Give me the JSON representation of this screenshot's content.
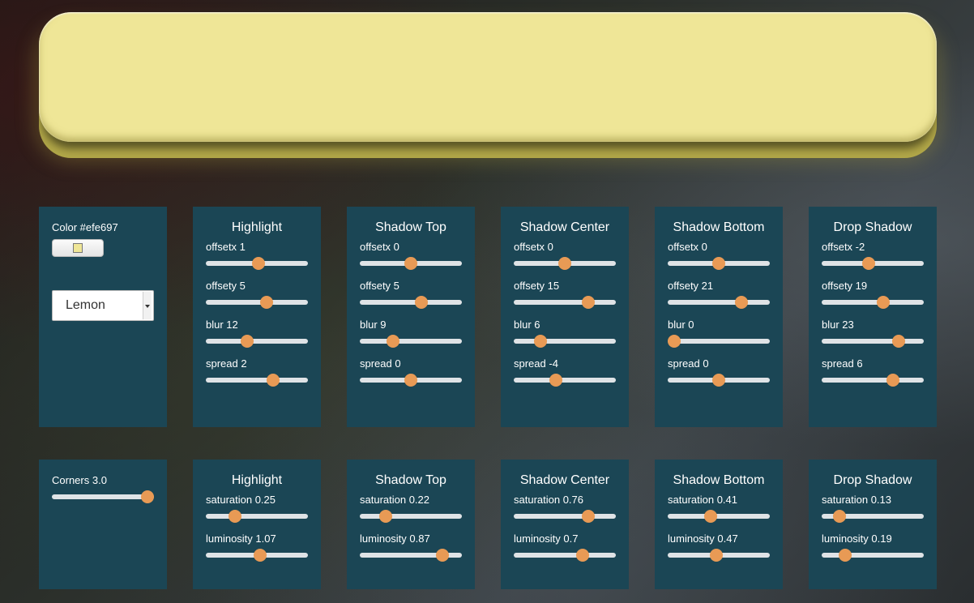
{
  "preview": {
    "color": "#efe697",
    "bottom_color": "#b7ad4d"
  },
  "panel_color": "#1b4655",
  "slider_thumb_color": "#e89a55",
  "color_panel": {
    "color_label": "Color #efe697",
    "swatch_color": "#efe697",
    "palette_select": {
      "selected": "Lemon"
    }
  },
  "corners_panel": {
    "label": "Corners 3.0",
    "level": 1.0
  },
  "shadow_panels": [
    {
      "title": "Highlight",
      "controls": [
        {
          "label": "offsetx 1",
          "level": 0.52
        },
        {
          "label": "offsety 5",
          "level": 0.61
        },
        {
          "label": "blur 12",
          "level": 0.39
        },
        {
          "label": "spread 2",
          "level": 0.68
        }
      ]
    },
    {
      "title": "Shadow Top",
      "controls": [
        {
          "label": "offsetx 0",
          "level": 0.5
        },
        {
          "label": "offsety 5",
          "level": 0.62
        },
        {
          "label": "blur 9",
          "level": 0.3
        },
        {
          "label": "spread 0",
          "level": 0.5
        }
      ]
    },
    {
      "title": "Shadow Center",
      "controls": [
        {
          "label": "offsetx 0",
          "level": 0.5
        },
        {
          "label": "offsety 15",
          "level": 0.76
        },
        {
          "label": "blur 6",
          "level": 0.23
        },
        {
          "label": "spread -4",
          "level": 0.4
        }
      ]
    },
    {
      "title": "Shadow Bottom",
      "controls": [
        {
          "label": "offsetx 0",
          "level": 0.5
        },
        {
          "label": "offsety 21",
          "level": 0.75
        },
        {
          "label": "blur 0",
          "level": 0.0
        },
        {
          "label": "spread 0",
          "level": 0.5
        }
      ]
    },
    {
      "title": "Drop Shadow",
      "controls": [
        {
          "label": "offsetx -2",
          "level": 0.45
        },
        {
          "label": "offsety 19",
          "level": 0.62
        },
        {
          "label": "blur 23",
          "level": 0.79
        },
        {
          "label": "spread 6",
          "level": 0.73
        }
      ]
    }
  ],
  "color_adjust_panels": [
    {
      "title": "Highlight",
      "controls": [
        {
          "label": "saturation 0.25",
          "level": 0.25
        },
        {
          "label": "luminosity 1.07",
          "level": 0.54
        }
      ]
    },
    {
      "title": "Shadow Top",
      "controls": [
        {
          "label": "saturation 0.22",
          "level": 0.22
        },
        {
          "label": "luminosity 0.87",
          "level": 0.85
        }
      ]
    },
    {
      "title": "Shadow Center",
      "controls": [
        {
          "label": "saturation 0.76",
          "level": 0.76
        },
        {
          "label": "luminosity 0.7",
          "level": 0.7
        }
      ]
    },
    {
      "title": "Shadow Bottom",
      "controls": [
        {
          "label": "saturation 0.41",
          "level": 0.41
        },
        {
          "label": "luminosity 0.47",
          "level": 0.47
        }
      ]
    },
    {
      "title": "Drop Shadow",
      "controls": [
        {
          "label": "saturation 0.13",
          "level": 0.13
        },
        {
          "label": "luminosity 0.19",
          "level": 0.19
        }
      ]
    }
  ]
}
